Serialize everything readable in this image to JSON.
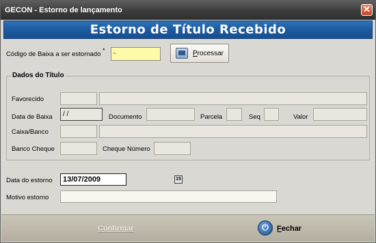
{
  "window": {
    "title": "GECON - Estorno de lançamento",
    "close_glyph": "✕"
  },
  "header": {
    "title": "Estorno de Título Recebido"
  },
  "form": {
    "codigo_label": "Código de Baixa a ser estornado",
    "required_mark": "*",
    "codigo_value": "-",
    "process_button": "Processar"
  },
  "group": {
    "title": "Dados do Título",
    "favorecido_label": "Favorecido",
    "data_baixa_label": "Data de Baixa",
    "data_baixa_value": "/ /",
    "documento_label": "Documento",
    "parcela_label": "Parcela",
    "seq_label": "Seq",
    "valor_label": "Valor",
    "caixa_banco_label": "Caixa/Banco",
    "banco_cheque_label": "Banco Cheque",
    "cheque_numero_label": "Cheque Número"
  },
  "estorno": {
    "data_label": "Data do estorno",
    "data_value": "13/07/2009",
    "calendar_glyph": "15",
    "motivo_label": "Motivo estorno",
    "motivo_value": ""
  },
  "footer": {
    "confirm_label": "Confirmar",
    "close_label": "Fechar",
    "power_glyph": "⏻"
  },
  "icons": {
    "process": "process-icon",
    "power": "power-icon",
    "calendar": "calendar-icon",
    "close": "close-icon"
  }
}
